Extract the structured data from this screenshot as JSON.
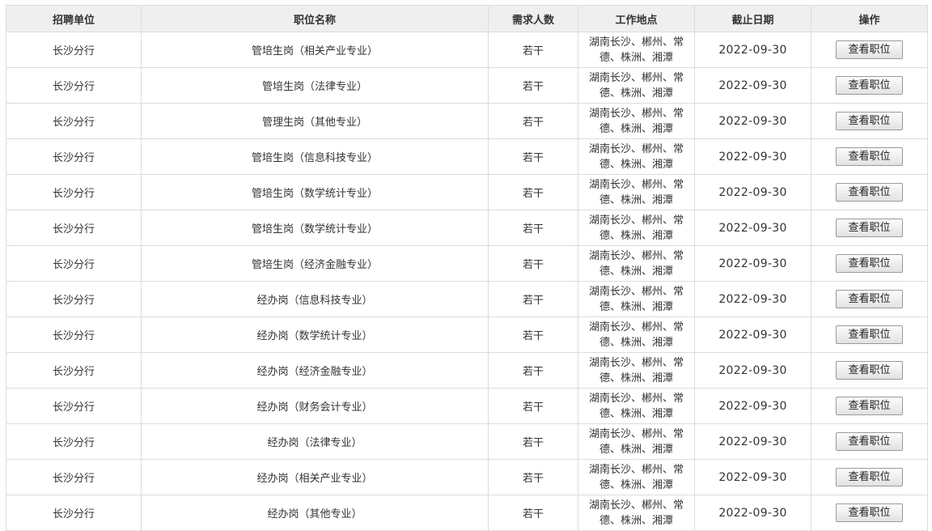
{
  "table": {
    "headers": {
      "unit": "招聘单位",
      "position": "职位名称",
      "count": "需求人数",
      "location": "工作地点",
      "deadline": "截止日期",
      "action": "操作"
    },
    "rows": [
      {
        "unit": "长沙分行",
        "position": "管培生岗（相关产业专业）",
        "count": "若干",
        "location": [
          "湖南长沙、郴州、常",
          "德、株洲、湘潭"
        ],
        "deadline": "2022-09-30",
        "action": "查看职位"
      },
      {
        "unit": "长沙分行",
        "position": "管培生岗（法律专业）",
        "count": "若干",
        "location": [
          "湖南长沙、郴州、常",
          "德、株洲、湘潭"
        ],
        "deadline": "2022-09-30",
        "action": "查看职位"
      },
      {
        "unit": "长沙分行",
        "position": "管理生岗（其他专业）",
        "count": "若干",
        "location": [
          "湖南长沙、郴州、常",
          "德、株洲、湘潭"
        ],
        "deadline": "2022-09-30",
        "action": "查看职位"
      },
      {
        "unit": "长沙分行",
        "position": "管培生岗（信息科技专业）",
        "count": "若干",
        "location": [
          "湖南长沙、郴州、常",
          "德、株洲、湘潭"
        ],
        "deadline": "2022-09-30",
        "action": "查看职位"
      },
      {
        "unit": "长沙分行",
        "position": "管培生岗（数学统计专业）",
        "count": "若干",
        "location": [
          "湖南长沙、郴州、常",
          "德、株洲、湘潭"
        ],
        "deadline": "2022-09-30",
        "action": "查看职位"
      },
      {
        "unit": "长沙分行",
        "position": "管培生岗（数学统计专业）",
        "count": "若干",
        "location": [
          "湖南长沙、郴州、常",
          "德、株洲、湘潭"
        ],
        "deadline": "2022-09-30",
        "action": "查看职位"
      },
      {
        "unit": "长沙分行",
        "position": "管培生岗（经济金融专业）",
        "count": "若干",
        "location": [
          "湖南长沙、郴州、常",
          "德、株洲、湘潭"
        ],
        "deadline": "2022-09-30",
        "action": "查看职位"
      },
      {
        "unit": "长沙分行",
        "position": "经办岗（信息科技专业）",
        "count": "若干",
        "location": [
          "湖南长沙、郴州、常",
          "德、株洲、湘潭"
        ],
        "deadline": "2022-09-30",
        "action": "查看职位"
      },
      {
        "unit": "长沙分行",
        "position": "经办岗（数学统计专业）",
        "count": "若干",
        "location": [
          "湖南长沙、郴州、常",
          "德、株洲、湘潭"
        ],
        "deadline": "2022-09-30",
        "action": "查看职位"
      },
      {
        "unit": "长沙分行",
        "position": "经办岗（经济金融专业）",
        "count": "若干",
        "location": [
          "湖南长沙、郴州、常",
          "德、株洲、湘潭"
        ],
        "deadline": "2022-09-30",
        "action": "查看职位"
      },
      {
        "unit": "长沙分行",
        "position": "经办岗（财务会计专业）",
        "count": "若干",
        "location": [
          "湖南长沙、郴州、常",
          "德、株洲、湘潭"
        ],
        "deadline": "2022-09-30",
        "action": "查看职位"
      },
      {
        "unit": "长沙分行",
        "position": "经办岗（法律专业）",
        "count": "若干",
        "location": [
          "湖南长沙、郴州、常",
          "德、株洲、湘潭"
        ],
        "deadline": "2022-09-30",
        "action": "查看职位"
      },
      {
        "unit": "长沙分行",
        "position": "经办岗（相关产业专业）",
        "count": "若干",
        "location": [
          "湖南长沙、郴州、常",
          "德、株洲、湘潭"
        ],
        "deadline": "2022-09-30",
        "action": "查看职位"
      },
      {
        "unit": "长沙分行",
        "position": "经办岗（其他专业）",
        "count": "若干",
        "location": [
          "湖南长沙、郴州、常",
          "德、株洲、湘潭"
        ],
        "deadline": "2022-09-30",
        "action": "查看职位"
      }
    ]
  }
}
